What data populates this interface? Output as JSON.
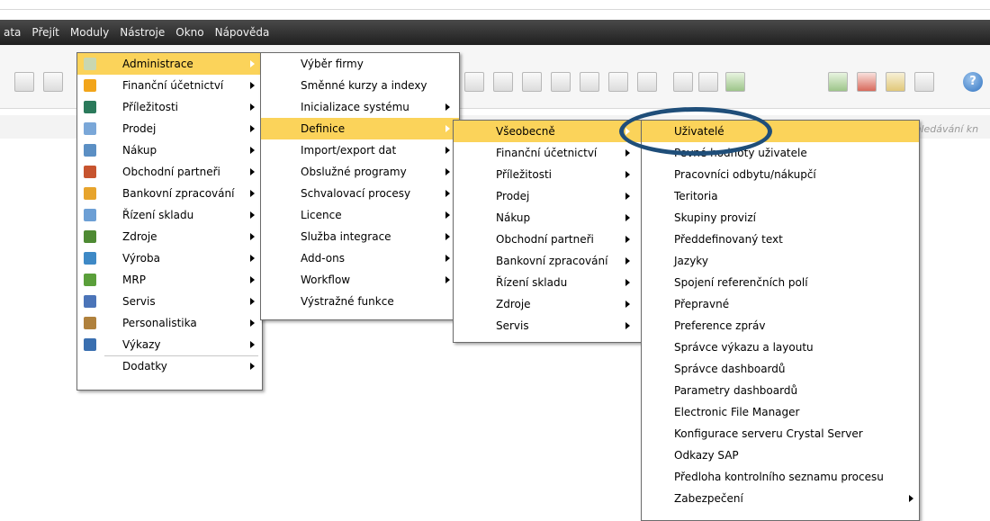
{
  "menubar": {
    "items": [
      "ata",
      "Přejít",
      "Moduly",
      "Nástroje",
      "Okno",
      "Nápověda"
    ]
  },
  "help_glyph": "?",
  "search_hint": "vhledávání kn",
  "menu_modules": [
    {
      "label": "Administrace",
      "icon": "administration-icon",
      "color": "#c9d7b0",
      "submenu": true,
      "highlight": true
    },
    {
      "label": "Finanční účetnictví",
      "icon": "pie-chart-icon",
      "color": "#f2a51a",
      "submenu": true
    },
    {
      "label": "Příležitosti",
      "icon": "opportunities-icon",
      "color": "#2b7a5b",
      "submenu": true
    },
    {
      "label": "Prodej",
      "icon": "sales-icon",
      "color": "#7aa7d8",
      "submenu": true
    },
    {
      "label": "Nákup",
      "icon": "cart-icon",
      "color": "#5b8fc4",
      "submenu": true
    },
    {
      "label": "Obchodní partneři",
      "icon": "partners-icon",
      "color": "#c7542f",
      "submenu": true
    },
    {
      "label": "Bankovní zpracování",
      "icon": "bank-icon",
      "color": "#e7a42c",
      "submenu": true
    },
    {
      "label": "Řízení skladu",
      "icon": "warehouse-icon",
      "color": "#6c9fd5",
      "submenu": true
    },
    {
      "label": "Zdroje",
      "icon": "resources-icon",
      "color": "#4e8a33",
      "submenu": true
    },
    {
      "label": "Výroba",
      "icon": "production-icon",
      "color": "#3e89c6",
      "submenu": true
    },
    {
      "label": "MRP",
      "icon": "mrp-icon",
      "color": "#5a9f3a",
      "submenu": true
    },
    {
      "label": "Servis",
      "icon": "service-icon",
      "color": "#4b74b8",
      "submenu": true
    },
    {
      "label": "Personalistika",
      "icon": "hr-icon",
      "color": "#b0813d",
      "submenu": true
    },
    {
      "label": "Výkazy",
      "icon": "reports-icon",
      "color": "#3a6fb0",
      "submenu": true
    },
    {
      "label": "Dodatky",
      "icon": "",
      "color": "",
      "submenu": true
    }
  ],
  "menu_admin": [
    {
      "label": "Výběr firmy",
      "submenu": false
    },
    {
      "label": "Směnné kurzy a indexy",
      "submenu": false
    },
    {
      "label": "Inicializace systému",
      "submenu": true
    },
    {
      "label": "Definice",
      "submenu": true,
      "highlight": true
    },
    {
      "label": "Import/export dat",
      "submenu": true
    },
    {
      "label": "Obslužné programy",
      "submenu": true
    },
    {
      "label": "Schvalovací procesy",
      "submenu": true
    },
    {
      "label": "Licence",
      "submenu": true
    },
    {
      "label": "Služba integrace",
      "submenu": true
    },
    {
      "label": "Add-ons",
      "submenu": true
    },
    {
      "label": "Workflow",
      "submenu": true
    },
    {
      "label": "Výstražné funkce",
      "submenu": false
    }
  ],
  "menu_definice": [
    {
      "label": "Všeobecně",
      "submenu": true,
      "highlight": true
    },
    {
      "label": "Finanční účetnictví",
      "submenu": true
    },
    {
      "label": "Příležitosti",
      "submenu": true
    },
    {
      "label": "Prodej",
      "submenu": true
    },
    {
      "label": "Nákup",
      "submenu": true
    },
    {
      "label": "Obchodní partneři",
      "submenu": true
    },
    {
      "label": "Bankovní zpracování",
      "submenu": true
    },
    {
      "label": "Řízení skladu",
      "submenu": true
    },
    {
      "label": "Zdroje",
      "submenu": true
    },
    {
      "label": "Servis",
      "submenu": true
    }
  ],
  "menu_vseobecne": [
    {
      "label": "Uživatelé",
      "submenu": false,
      "highlight": true
    },
    {
      "label": "Pevné hodnoty uživatele",
      "submenu": false
    },
    {
      "label": "Pracovníci odbytu/nákupčí",
      "submenu": false
    },
    {
      "label": "Teritoria",
      "submenu": false
    },
    {
      "label": "Skupiny provizí",
      "submenu": false
    },
    {
      "label": "Předdefinovaný text",
      "submenu": false
    },
    {
      "label": "Jazyky",
      "submenu": false
    },
    {
      "label": "Spojení referenčních polí",
      "submenu": false
    },
    {
      "label": "Přepravné",
      "submenu": false
    },
    {
      "label": "Preference zpráv",
      "submenu": false
    },
    {
      "label": "Správce výkazu a layoutu",
      "submenu": false
    },
    {
      "label": "Správce dashboardů",
      "submenu": false
    },
    {
      "label": "Parametry dashboardů",
      "submenu": false
    },
    {
      "label": "Electronic File Manager",
      "submenu": false
    },
    {
      "label": "Konfigurace serveru Crystal Server",
      "submenu": false
    },
    {
      "label": "Odkazy SAP",
      "submenu": false
    },
    {
      "label": "Předloha kontrolního seznamu procesu",
      "submenu": false
    },
    {
      "label": "Zabezpečení",
      "submenu": true
    }
  ],
  "colors": {
    "highlight": "#fbd35a",
    "menubar": "#2e2e2e",
    "annotation_ellipse": "#1f4e79"
  }
}
